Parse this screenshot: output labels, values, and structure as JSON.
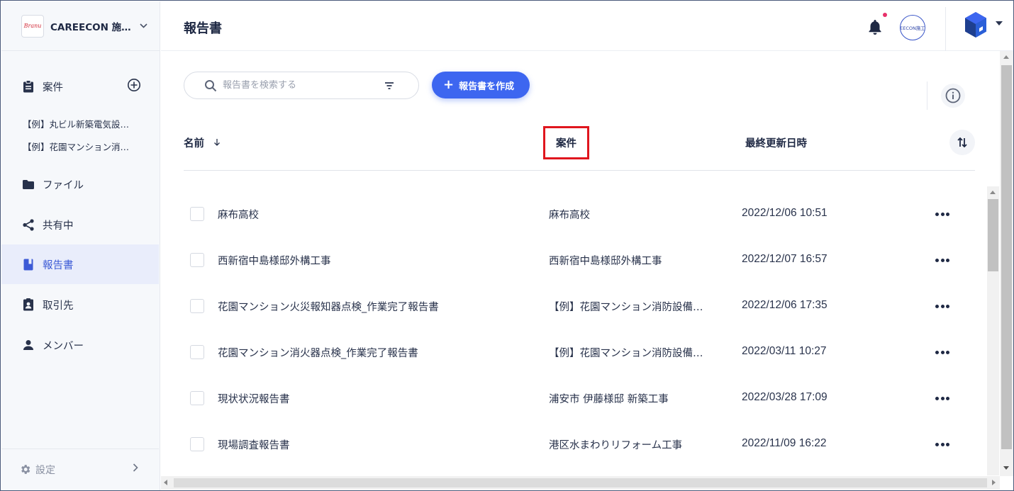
{
  "sidebar": {
    "company_logo_text": "Branu",
    "company_name": "CAREECON 施…",
    "nav": {
      "cases": "案件",
      "files": "ファイル",
      "shared": "共有中",
      "reports": "報告書",
      "clients": "取引先",
      "members": "メンバー"
    },
    "case_items": [
      "【例】丸ビル新築電気設…",
      "【例】花園マンション消…"
    ],
    "settings": "設定"
  },
  "header": {
    "title": "報告書",
    "avatar_text": "EECON施工"
  },
  "toolbar": {
    "search_placeholder": "報告書を検索する",
    "create_label": "報告書を作成"
  },
  "table": {
    "columns": {
      "name": "名前",
      "case": "案件",
      "updated": "最終更新日時"
    },
    "rows": [
      {
        "name": "麻布高校",
        "case": "麻布高校",
        "updated": "2022/12/06 10:51"
      },
      {
        "name": "西新宿中島様邸外構工事",
        "case": "西新宿中島様邸外構工事",
        "updated": "2022/12/07 16:57"
      },
      {
        "name": "花園マンション火災報知器点検_作業完了報告書",
        "case": "【例】花園マンション消防設備…",
        "updated": "2022/12/06 17:35"
      },
      {
        "name": "花園マンション消火器点検_作業完了報告書",
        "case": "【例】花園マンション消防設備…",
        "updated": "2022/03/11 10:27"
      },
      {
        "name": "現状状況報告書",
        "case": "浦安市 伊藤様邸 新築工事",
        "updated": "2022/03/28 17:09"
      },
      {
        "name": "現場調査報告書",
        "case": "港区水まわりリフォーム工事",
        "updated": "2022/11/09 16:22"
      }
    ]
  },
  "colors": {
    "accent": "#3d66f0",
    "highlight_border": "#e0161e",
    "active_nav_bg": "#e9edfb",
    "notification_dot": "#e8306a"
  }
}
